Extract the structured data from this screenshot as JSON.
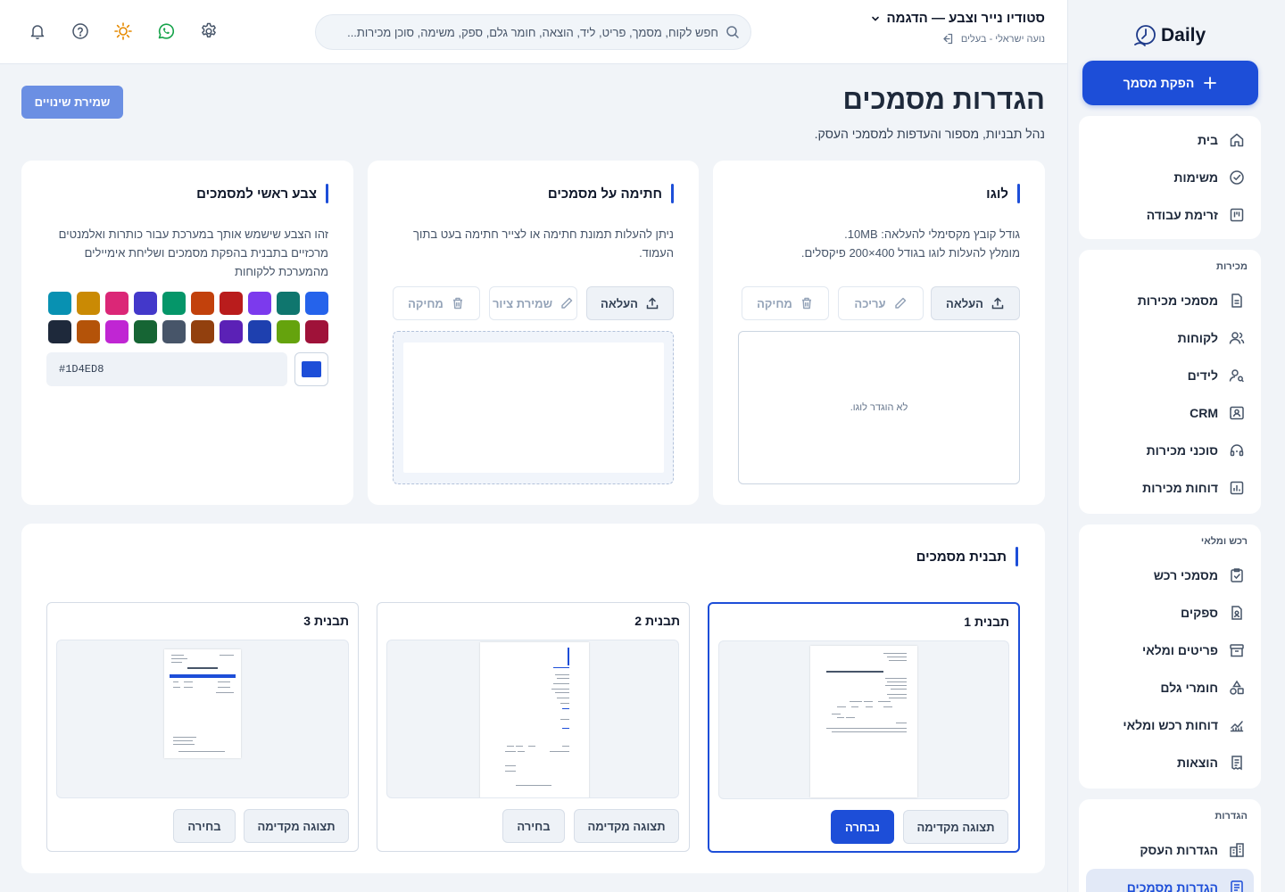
{
  "app": {
    "logo_text": "Daily",
    "cta_label": "הפקת מסמך"
  },
  "sidebar": {
    "top_items": [
      {
        "label": "בית",
        "icon": "home-icon"
      },
      {
        "label": "משימות",
        "icon": "check-circle-icon"
      },
      {
        "label": "זרימת עבודה",
        "icon": "kanban-icon"
      }
    ],
    "sales": {
      "title": "מכירות",
      "items": [
        {
          "label": "מסמכי מכירות",
          "icon": "document-icon"
        },
        {
          "label": "לקוחות",
          "icon": "users-icon"
        },
        {
          "label": "לידים",
          "icon": "user-search-icon"
        },
        {
          "label": "CRM",
          "icon": "contact-card-icon"
        },
        {
          "label": "סוכני מכירות",
          "icon": "headset-icon"
        },
        {
          "label": "דוחות מכירות",
          "icon": "chart-icon"
        }
      ]
    },
    "procurement": {
      "title": "רכש ומלאי",
      "items": [
        {
          "label": "מסמכי רכש",
          "icon": "clipboard-check-icon"
        },
        {
          "label": "ספקים",
          "icon": "supplier-icon"
        },
        {
          "label": "פריטים ומלאי",
          "icon": "archive-icon"
        },
        {
          "label": "חומרי גלם",
          "icon": "shapes-icon"
        },
        {
          "label": "דוחות רכש ומלאי",
          "icon": "line-chart-icon"
        },
        {
          "label": "הוצאות",
          "icon": "receipt-icon"
        }
      ]
    },
    "settings": {
      "title": "הגדרות",
      "items": [
        {
          "label": "הגדרות העסק",
          "icon": "building-icon"
        },
        {
          "label": "הגדרות מסמכים",
          "icon": "document-settings-icon",
          "active": true
        }
      ]
    }
  },
  "topbar": {
    "business_name": "סטודיו נייר וצבע — הדגמה",
    "user_line": "נועה ישראלי - בעלים",
    "search_placeholder": "חפש לקוח, מסמך, פריט, ליד, הוצאה, חומר גלם, ספק, משימה, סוכן מכירות..."
  },
  "page": {
    "title": "הגדרות מסמכים",
    "subtitle": "נהל תבניות, מספור והעדפות למסמכי העסק.",
    "save_label": "שמירת שינויים"
  },
  "logo_card": {
    "title": "לוגו",
    "desc_line1": "גודל קובץ מקסימלי להעלאה: 10MB.",
    "desc_line2": "מומלץ להעלות לוגו בגודל 400×200 פיקסלים.",
    "upload_label": "העלאה",
    "edit_label": "עריכה",
    "delete_label": "מחיקה",
    "empty_text": "לא הוגדר לוגו."
  },
  "signature_card": {
    "title": "חתימה על מסמכים",
    "desc_line1": "ניתן להעלות תמונת חתימה או לצייר חתימה בעט בתוך",
    "desc_line2": "העמוד.",
    "upload_label": "העלאה",
    "save_drawing_label": "שמירת ציור",
    "delete_label": "מחיקה"
  },
  "color_card": {
    "title": "צבע ראשי למסמכים",
    "desc_line1": "זהו הצבע שישמש אותך במערכת עבור כותרות ואלמנטים",
    "desc_line2": "מרכזיים בתבנית בהפקת מסמכים ושליחת אימיילים",
    "desc_line3": "מהמערכת ללקוחות",
    "hex_value": "#1D4ED8",
    "selected_color": "#1d4ed8",
    "palette_row1": [
      "#2563eb",
      "#0f766e",
      "#7c3aed",
      "#b91c1c",
      "#c2410c",
      "#059669",
      "#4338ca",
      "#db2777",
      "#ca8a04",
      "#0891b2"
    ],
    "palette_row2": [
      "#9f1239",
      "#65a30d",
      "#1e40af",
      "#5b21b6",
      "#92400e",
      "#475569",
      "#166534",
      "#c026d3",
      "#b45309",
      "#1e293b"
    ]
  },
  "templates_card": {
    "title": "תבנית מסמכים",
    "templates": [
      {
        "name": "תבנית 1",
        "preview_label": "תצוגה מקדימה",
        "choose_label": "נבחרה",
        "selected": true
      },
      {
        "name": "תבנית 2",
        "preview_label": "תצוגה מקדימה",
        "choose_label": "בחירה",
        "selected": false
      },
      {
        "name": "תבנית 3",
        "preview_label": "תצוגה מקדימה",
        "choose_label": "בחירה",
        "selected": false
      }
    ]
  }
}
